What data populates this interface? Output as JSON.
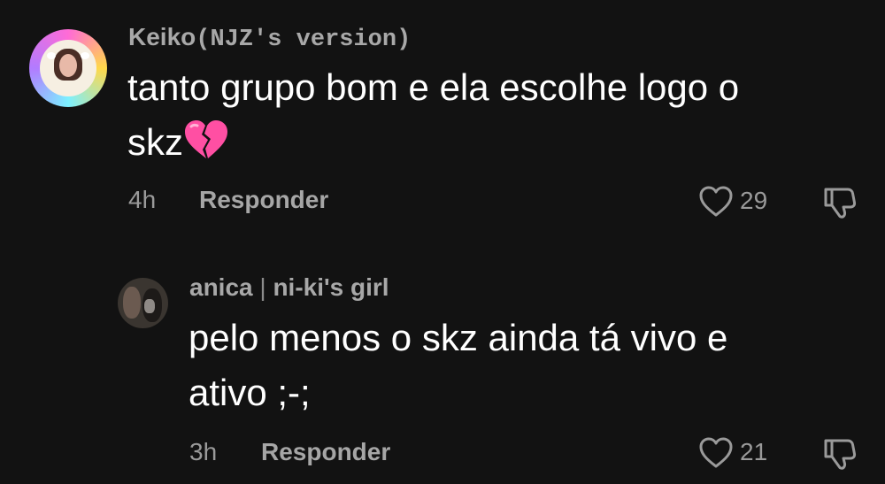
{
  "comments": [
    {
      "username_main": "Keiko",
      "username_suffix": "(NJZ's version)",
      "text_line1": "tanto grupo bom e ela escolhe logo o",
      "text_line2": "skz",
      "emoji": "broken-heart",
      "time": "4h",
      "reply_label": "Responder",
      "likes": "29",
      "icons": {
        "like": "heart-outline-icon",
        "dislike": "thumbs-down-icon"
      }
    },
    {
      "username_main": "anica",
      "username_sep": "|",
      "username_suffix": "ni-ki's girl",
      "text_line1": "pelo menos o skz ainda tá vivo e",
      "text_line2": "ativo ;-;",
      "time": "3h",
      "reply_label": "Responder",
      "likes": "21",
      "icons": {
        "like": "heart-outline-icon",
        "dislike": "thumbs-down-icon"
      }
    }
  ],
  "colors": {
    "background": "#121212",
    "username": "#a8a8a8",
    "meta": "#9a9a9a",
    "text": "#ffffff",
    "heartbreak": "#ff4fa3"
  }
}
